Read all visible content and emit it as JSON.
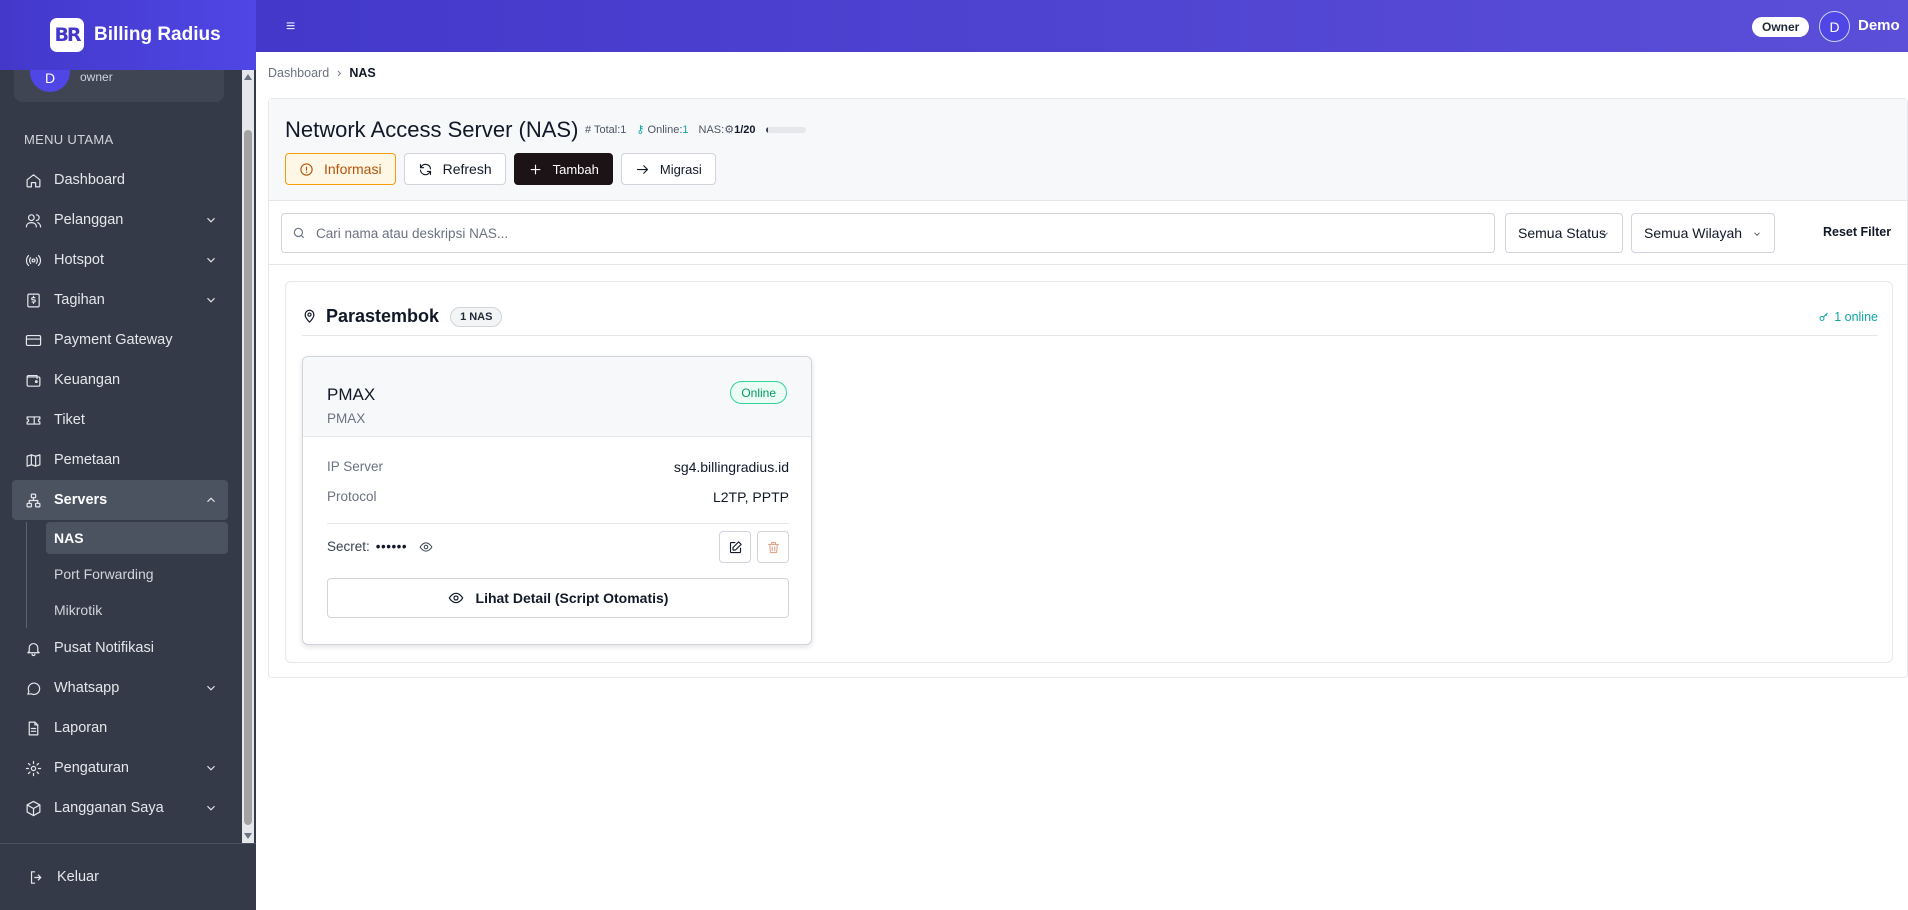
{
  "brand": {
    "logo_text": "BR",
    "name": "Billing Radius"
  },
  "user_card": {
    "initial": "D",
    "role": "owner"
  },
  "menu_title": "MENU UTAMA",
  "menu": {
    "dashboard": "Dashboard",
    "pelanggan": "Pelanggan",
    "hotspot": "Hotspot",
    "tagihan": "Tagihan",
    "payment_gateway": "Payment Gateway",
    "keuangan": "Keuangan",
    "tiket": "Tiket",
    "pemetaan": "Pemetaan",
    "servers": "Servers",
    "nas": "NAS",
    "port_forwarding": "Port Forwarding",
    "mikrotik": "Mikrotik",
    "pusat_notifikasi": "Pusat Notifikasi",
    "whatsapp": "Whatsapp",
    "laporan": "Laporan",
    "pengaturan": "Pengaturan",
    "langganan_saya": "Langganan Saya",
    "keluar": "Keluar"
  },
  "topbar": {
    "menu_glyph": "≡",
    "role_badge": "Owner",
    "avatar_initial": "D",
    "username": "Demo"
  },
  "breadcrumb": {
    "root": "Dashboard",
    "sep": "›",
    "current": "NAS"
  },
  "page": {
    "title": "Network Access Server (NAS)",
    "stats": {
      "total_label": "# Total:",
      "total": "1",
      "online_label": "Online:",
      "online": "1",
      "nas_label": "NAS:",
      "nas_quota": "1/20",
      "quota_fraction": 0.05
    }
  },
  "actions": {
    "informasi": "Informasi",
    "refresh": "Refresh",
    "tambah": "Tambah",
    "migrasi": "Migrasi"
  },
  "filters": {
    "search_placeholder": "Cari nama atau deskripsi NAS...",
    "status": "Semua Status",
    "wilayah": "Semua Wilayah",
    "reset": "Reset Filter"
  },
  "group": {
    "name": "Parastembok",
    "count": "1 NAS",
    "online_summary": "1 online"
  },
  "nas_card": {
    "name": "PMAX",
    "description": "PMAX",
    "status": "Online",
    "ip_label": "IP Server",
    "ip_value": "sg4.billingradius.id",
    "protocol_label": "Protocol",
    "protocol_value": "L2TP, PPTP",
    "secret_label": "Secret:",
    "secret_value": "••••••",
    "detail_button": "Lihat Detail (Script Otomatis)"
  },
  "colors": {
    "accent": "#4f46e5",
    "sidebar": "#343a47",
    "online": "#059669",
    "warning": "#f59e0b"
  }
}
